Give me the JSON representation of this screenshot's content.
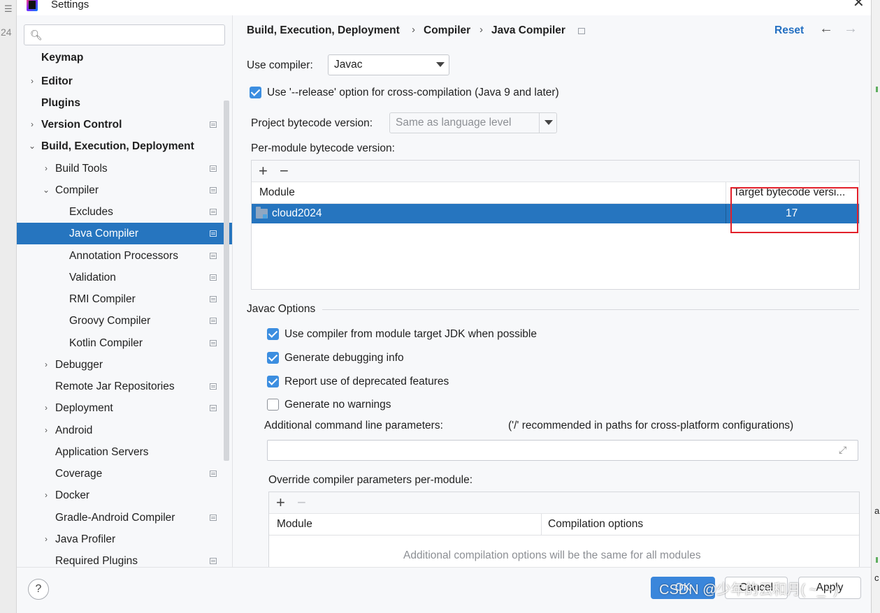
{
  "background": {
    "left_number": "24",
    "right_fragment_1": "a",
    "right_fragment_2": "c"
  },
  "window": {
    "title": "Settings",
    "close": "✕"
  },
  "sidebar": {
    "search_placeholder": "",
    "items": [
      {
        "label": "Keymap",
        "bold": true
      },
      {
        "label": "Editor",
        "bold": true
      },
      {
        "label": "Plugins",
        "bold": true
      },
      {
        "label": "Version Control",
        "bold": true
      },
      {
        "label": "Build, Execution, Deployment",
        "bold": true
      },
      {
        "label": "Build Tools"
      },
      {
        "label": "Compiler"
      },
      {
        "label": "Excludes"
      },
      {
        "label": "Java Compiler",
        "selected": true
      },
      {
        "label": "Annotation Processors"
      },
      {
        "label": "Validation"
      },
      {
        "label": "RMI Compiler"
      },
      {
        "label": "Groovy Compiler"
      },
      {
        "label": "Kotlin Compiler"
      },
      {
        "label": "Debugger"
      },
      {
        "label": "Remote Jar Repositories"
      },
      {
        "label": "Deployment"
      },
      {
        "label": "Android"
      },
      {
        "label": "Application Servers"
      },
      {
        "label": "Coverage"
      },
      {
        "label": "Docker"
      },
      {
        "label": "Gradle-Android Compiler"
      },
      {
        "label": "Java Profiler"
      },
      {
        "label": "Required Plugins"
      }
    ]
  },
  "breadcrumb": {
    "part1": "Build, Execution, Deployment",
    "sep": "›",
    "part2": "Compiler",
    "part3": "Java Compiler"
  },
  "header": {
    "reset": "Reset",
    "back": "←",
    "forward": "→"
  },
  "compiler": {
    "use_compiler_label": "Use compiler:",
    "use_compiler_value": "Javac",
    "release_option_label": "Use '--release' option for cross-compilation (Java 9 and later)",
    "release_option_checked": true,
    "project_bytecode_label": "Project bytecode version:",
    "project_bytecode_value": "Same as language level",
    "per_module_label": "Per-module bytecode version:",
    "module_table": {
      "add": "+",
      "remove": "−",
      "col_module": "Module",
      "col_target": "Target bytecode versi...",
      "rows": [
        {
          "module": "cloud2024",
          "target": "17"
        }
      ]
    }
  },
  "javac_options": {
    "section_title": "Javac Options",
    "checks": [
      {
        "label": "Use compiler from module target JDK when possible",
        "checked": true
      },
      {
        "label": "Generate debugging info",
        "checked": true
      },
      {
        "label": "Report use of deprecated features",
        "checked": true
      },
      {
        "label": "Generate no warnings",
        "checked": false
      }
    ],
    "additional_params_label": "Additional command line parameters:",
    "additional_params_hint": "('/' recommended in paths for cross-platform configurations)",
    "additional_params_value": "",
    "override_label": "Override compiler parameters per-module:",
    "override_table": {
      "add": "+",
      "remove": "−",
      "col_module": "Module",
      "col_options": "Compilation options",
      "empty_text": "Additional compilation options will be the same for all modules"
    }
  },
  "footer": {
    "help": "?",
    "ok": "OK",
    "cancel": "Cancel",
    "apply": "Apply",
    "watermark": "CSDN @少年的云和月( ~_~)"
  },
  "colors": {
    "accent": "#2675bf",
    "link": "#2470c2",
    "checkbox": "#3c8ee0",
    "highlight_box": "#e2202a"
  }
}
